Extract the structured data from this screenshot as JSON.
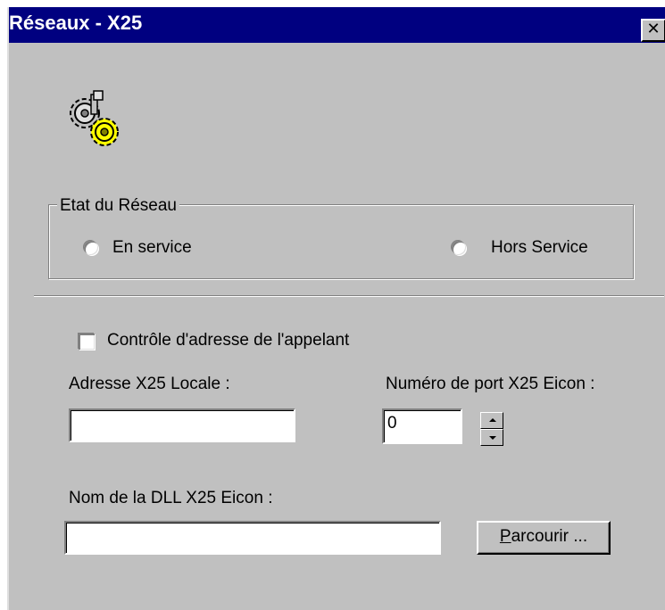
{
  "window": {
    "title": "Réseaux - X25",
    "close_glyph": "✕"
  },
  "icon": "gears-icon",
  "network_state": {
    "legend": "Etat du Réseau",
    "options": [
      {
        "label": "En service",
        "selected": false
      },
      {
        "label": "Hors Service",
        "selected": false
      }
    ]
  },
  "caller_check": {
    "label": "Contrôle d'adresse de l'appelant",
    "checked": false
  },
  "local_address": {
    "label": "Adresse X25 Locale :",
    "value": ""
  },
  "port": {
    "label": "Numéro de port X25 Eicon :",
    "value": "0"
  },
  "dll": {
    "label": "Nom de la DLL X25 Eicon :",
    "value": ""
  },
  "browse_button": {
    "label_first": "P",
    "label_rest": "arcourir ..."
  },
  "colors": {
    "titlebar": "#000080",
    "face": "#c0c0c0",
    "gear_accent": "#ffff00"
  }
}
